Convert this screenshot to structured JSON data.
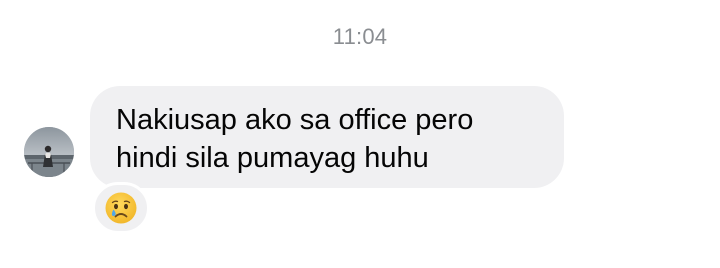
{
  "timestamp": "11:04",
  "message": {
    "lines": [
      "Nakiusap ako sa office pero",
      "hindi sila pumayag huhu"
    ]
  },
  "reaction": {
    "icon": "crying-face-icon",
    "emoji": "😢"
  },
  "colors": {
    "bubble": "#f0f0f2",
    "text": "#050505",
    "timestamp": "#8a8d91",
    "emoji_face": "#f7c23a"
  }
}
